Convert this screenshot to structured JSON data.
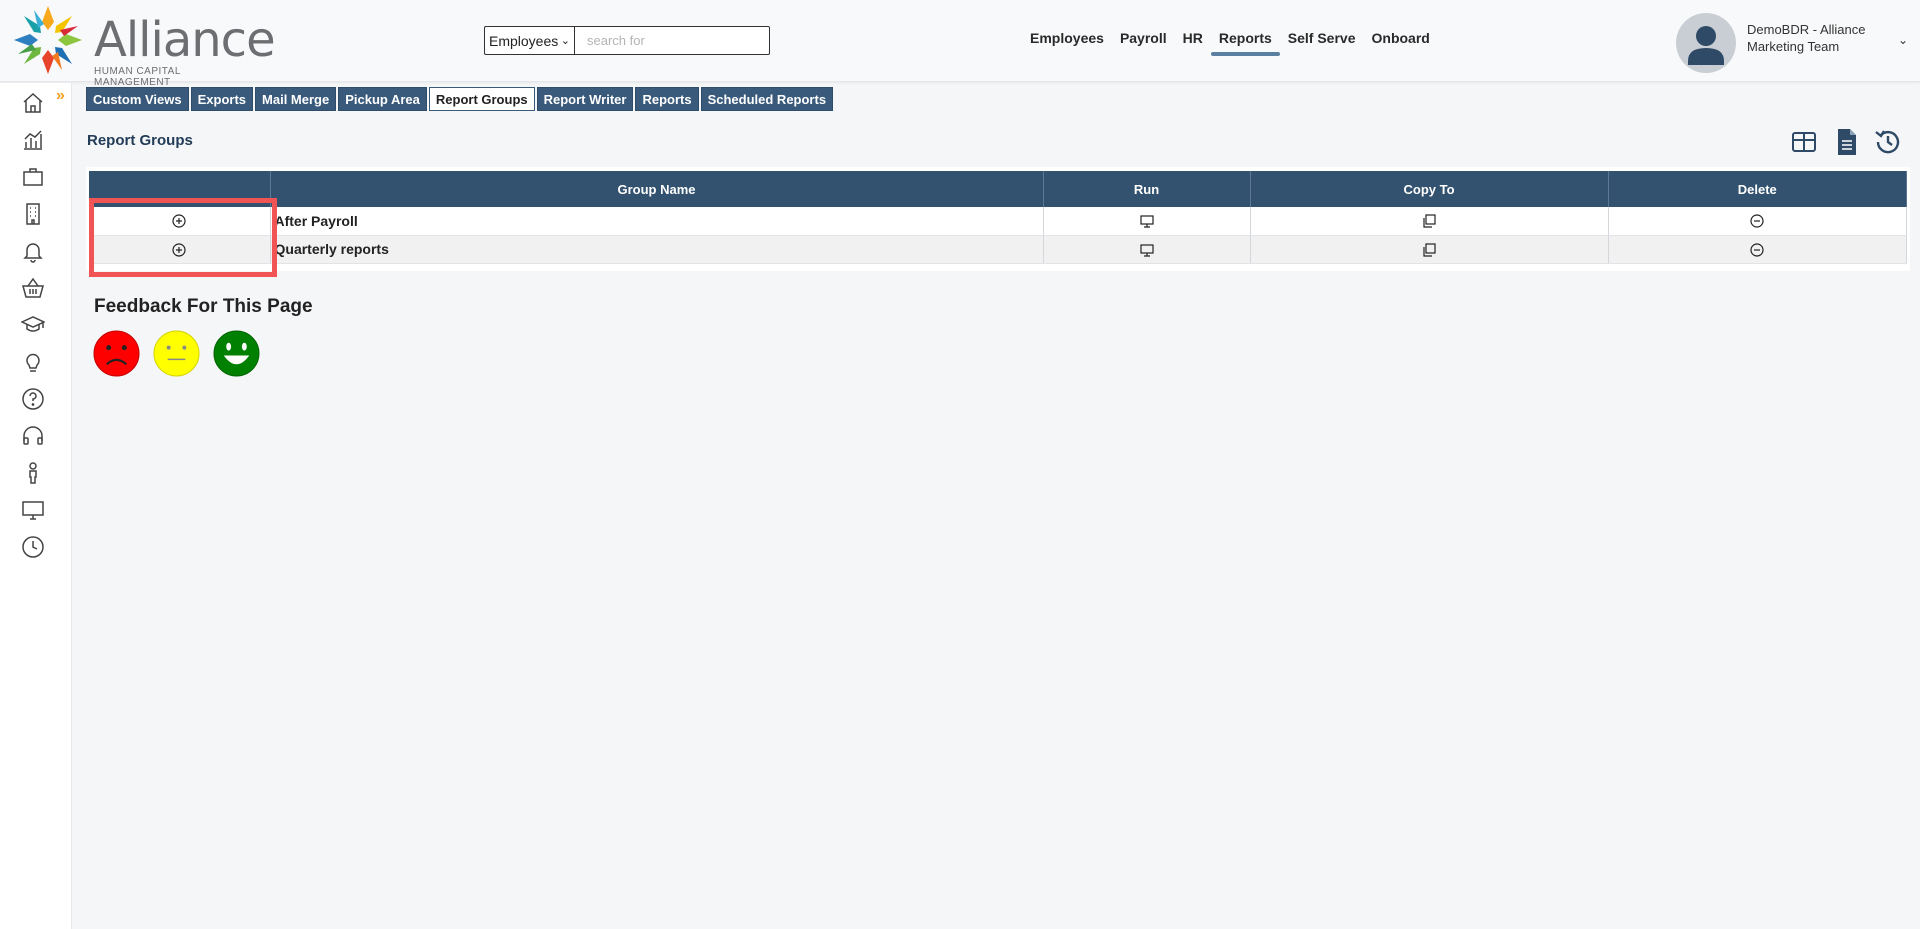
{
  "header": {
    "logo": {
      "name": "Alliance",
      "subtitle": "HUMAN CAPITAL MANAGEMENT"
    },
    "search": {
      "category": "Employees",
      "placeholder": "search for"
    },
    "nav": [
      {
        "label": "Employees",
        "active": false
      },
      {
        "label": "Payroll",
        "active": false
      },
      {
        "label": "HR",
        "active": false
      },
      {
        "label": "Reports",
        "active": true
      },
      {
        "label": "Self Serve",
        "active": false
      },
      {
        "label": "Onboard",
        "active": false
      }
    ],
    "user": {
      "name": "DemoBDR - Alliance Marketing Team"
    }
  },
  "sidebar": {
    "items": [
      "home-icon",
      "analytics-icon",
      "briefcase-icon",
      "building-icon",
      "bell-icon",
      "basket-icon",
      "graduation-cap-icon",
      "lightbulb-icon",
      "help-icon",
      "headphones-icon",
      "person-icon",
      "monitor-icon",
      "clock-icon"
    ]
  },
  "subtabs": [
    {
      "label": "Custom Views",
      "active": false
    },
    {
      "label": "Exports",
      "active": false
    },
    {
      "label": "Mail Merge",
      "active": false
    },
    {
      "label": "Pickup Area",
      "active": false
    },
    {
      "label": "Report Groups",
      "active": true
    },
    {
      "label": "Report Writer",
      "active": false
    },
    {
      "label": "Reports",
      "active": false
    },
    {
      "label": "Scheduled Reports",
      "active": false
    }
  ],
  "page": {
    "title": "Report Groups",
    "toolbar": [
      "grid-view-icon",
      "document-icon",
      "history-icon"
    ]
  },
  "table": {
    "columns": [
      "",
      "Group Name",
      "Run",
      "Copy To",
      "Delete"
    ],
    "rows": [
      {
        "name": "After Payroll"
      },
      {
        "name": "Quarterly reports"
      }
    ]
  },
  "feedback": {
    "title": "Feedback For This Page",
    "colors": {
      "sad": "#ff0000",
      "neutral": "#ffff00",
      "happy": "#008000"
    }
  },
  "colors": {
    "header_blue": "#32526f",
    "tab_blue": "#3a5a7c",
    "highlight": "#f05454",
    "nav_underline": "#5b7fa0"
  }
}
